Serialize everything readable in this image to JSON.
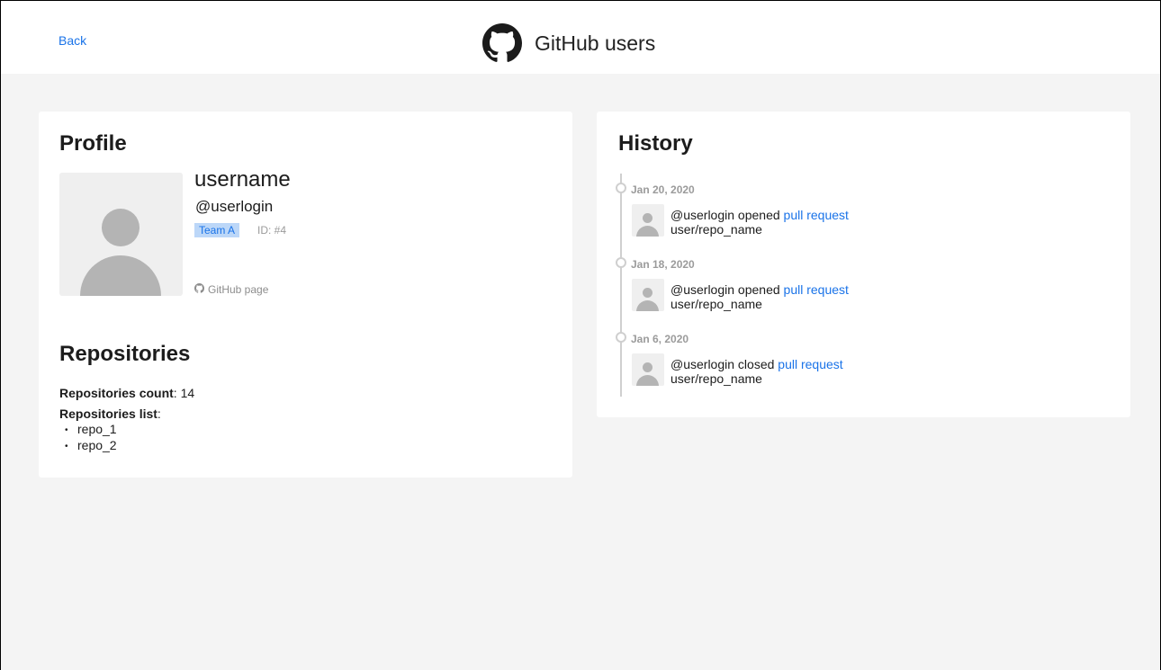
{
  "header": {
    "back_label": "Back",
    "title": "GitHub users",
    "logo_icon": "github-octocat-icon"
  },
  "profile": {
    "section_title": "Profile",
    "username": "username",
    "login": "@userlogin",
    "team_badge": "Team A",
    "id_text": "ID: #4",
    "github_link_label": "GitHub page",
    "github_link_icon": "github-icon",
    "avatar_icon": "user-placeholder-icon"
  },
  "repositories": {
    "section_title": "Repositories",
    "count_label": "Repositories count",
    "count_value": ": 14",
    "list_label": "Repositories list",
    "list_suffix": ":",
    "items": [
      "repo_1",
      "repo_2"
    ]
  },
  "history": {
    "section_title": "History",
    "events": [
      {
        "date": "Jan 20, 2020",
        "actor": "@userlogin",
        "action": "opened",
        "link_label": "pull request",
        "repo": "user/repo_name"
      },
      {
        "date": "Jan 18, 2020",
        "actor": "@userlogin",
        "action": "opened",
        "link_label": "pull request",
        "repo": "user/repo_name"
      },
      {
        "date": "Jan 6, 2020",
        "actor": "@userlogin",
        "action": "closed",
        "link_label": "pull request",
        "repo": "user/repo_name"
      }
    ]
  },
  "colors": {
    "accent": "#1a73e8",
    "badge_bg": "#bcd7f8",
    "page_bg": "#f4f4f4",
    "muted": "#9b9b9b"
  }
}
